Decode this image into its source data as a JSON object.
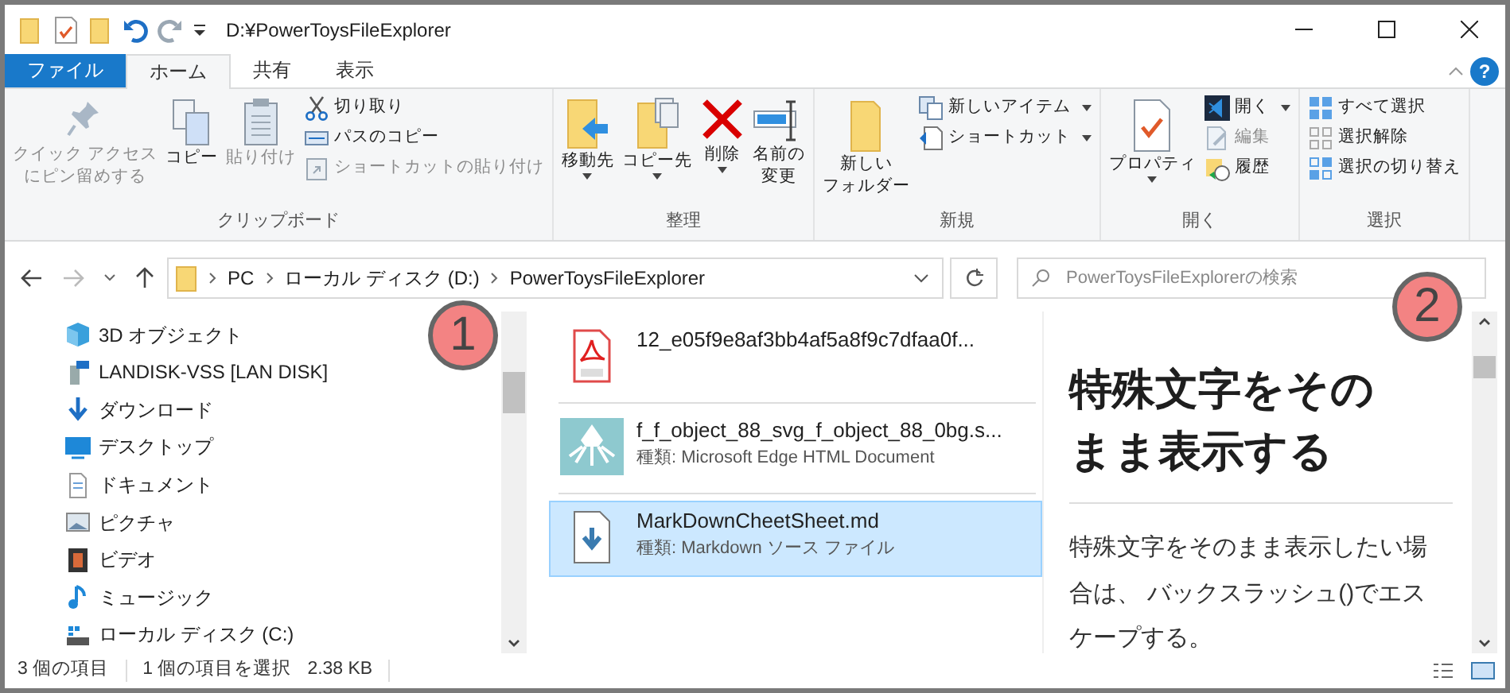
{
  "window": {
    "title": "D:¥PowerToysFileExplorer"
  },
  "ribbon_tabs": [
    {
      "label": "ファイル",
      "kind": "file",
      "selected": false
    },
    {
      "label": "ホーム",
      "kind": "tab",
      "selected": true
    },
    {
      "label": "共有",
      "kind": "tab",
      "selected": false
    },
    {
      "label": "表示",
      "kind": "tab",
      "selected": false
    }
  ],
  "help": {
    "label": "?"
  },
  "ribbon_groups": [
    {
      "label": "クリップボード",
      "items": [
        {
          "kind": "large",
          "lines": [
            "クイック アクセス",
            "にピン留めする"
          ],
          "disabled": true,
          "dropdown": false
        },
        {
          "kind": "large",
          "lines": [
            "コピー"
          ],
          "disabled": false,
          "dropdown": false
        },
        {
          "kind": "large",
          "lines": [
            "貼り付け"
          ],
          "disabled": true,
          "dropdown": false
        },
        {
          "kind": "small",
          "label": "切り取り",
          "disabled": false,
          "dropdown": false
        },
        {
          "kind": "small",
          "label": "パスのコピー",
          "disabled": false,
          "dropdown": false
        },
        {
          "kind": "small",
          "label": "ショートカットの貼り付け",
          "disabled": true,
          "dropdown": false
        }
      ]
    },
    {
      "label": "整理",
      "items": [
        {
          "kind": "large",
          "lines": [
            "移動先"
          ],
          "disabled": false,
          "dropdown": true
        },
        {
          "kind": "large",
          "lines": [
            "コピー先"
          ],
          "disabled": false,
          "dropdown": true
        },
        {
          "kind": "large",
          "lines": [
            "削除"
          ],
          "disabled": false,
          "dropdown": true
        },
        {
          "kind": "large",
          "lines": [
            "名前の",
            "変更"
          ],
          "disabled": false,
          "dropdown": false
        }
      ]
    },
    {
      "label": "新規",
      "items": [
        {
          "kind": "large",
          "lines": [
            "新しい",
            "フォルダー"
          ],
          "disabled": false,
          "dropdown": false
        },
        {
          "kind": "small",
          "label": "新しいアイテム",
          "disabled": false,
          "dropdown": true
        },
        {
          "kind": "small",
          "label": "ショートカット",
          "disabled": false,
          "dropdown": true
        }
      ]
    },
    {
      "label": "開く",
      "items": [
        {
          "kind": "large",
          "lines": [
            "プロパティ"
          ],
          "disabled": false,
          "dropdown": true
        },
        {
          "kind": "small",
          "label": "開く",
          "disabled": false,
          "dropdown": true
        },
        {
          "kind": "small",
          "label": "編集",
          "disabled": true,
          "dropdown": false
        },
        {
          "kind": "small",
          "label": "履歴",
          "disabled": false,
          "dropdown": false
        }
      ]
    },
    {
      "label": "選択",
      "items": [
        {
          "kind": "small",
          "label": "すべて選択",
          "disabled": false,
          "dropdown": false
        },
        {
          "kind": "small",
          "label": "選択解除",
          "disabled": false,
          "dropdown": false
        },
        {
          "kind": "small",
          "label": "選択の切り替え",
          "disabled": false,
          "dropdown": false
        }
      ]
    }
  ],
  "address": {
    "breadcrumbs": [
      "PC",
      "ローカル ディスク (D:)",
      "PowerToysFileExplorer"
    ]
  },
  "search": {
    "placeholder": "PowerToysFileExplorerの検索"
  },
  "sidebar": {
    "items": [
      "3D オブジェクト",
      "LANDISK-VSS [LAN DISK]",
      "ダウンロード",
      "デスクトップ",
      "ドキュメント",
      "ピクチャ",
      "ビデオ",
      "ミュージック",
      "ローカル ディスク (C:)"
    ]
  },
  "files": [
    {
      "name": "12_e05f9e8af3bb4af5a8f9c7dfaa0f...",
      "selected": false
    },
    {
      "name": "f_f_object_88_svg_f_object_88_0bg.s...",
      "type": "種類: Microsoft Edge HTML Document",
      "selected": false
    },
    {
      "name": "MarkDownCheetSheet.md",
      "type": "種類: Markdown ソース ファイル",
      "selected": true
    }
  ],
  "preview": {
    "heading": "特殊文字をそのまま表示する",
    "paragraph": "特殊文字をそのまま表示したい場合は、 バックスラッシュ()でエスケープする。"
  },
  "status_bar": {
    "item_count": "3 個の項目",
    "selection": "1 個の項目を選択",
    "size": "2.38 KB"
  },
  "callouts": [
    "1",
    "2"
  ]
}
